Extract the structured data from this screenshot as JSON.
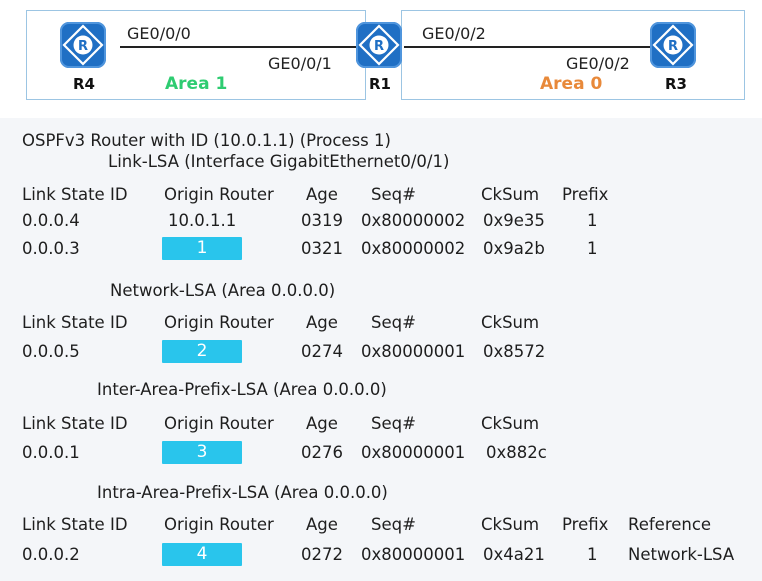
{
  "topology": {
    "routers": [
      {
        "id": "r4",
        "name": "R4"
      },
      {
        "id": "r1",
        "name": "R1"
      },
      {
        "id": "r3",
        "name": "R3"
      }
    ],
    "icon_letter": "R",
    "interfaces": {
      "r4_if": "GE0/0/0",
      "r1_left_if": "GE0/0/1",
      "r1_right_if": "GE0/0/2",
      "r3_if": "GE0/0/2"
    },
    "areas": {
      "area1": {
        "label": "Area 1",
        "color": "#2ecc71"
      },
      "area0": {
        "label": "Area 0",
        "color": "#e8893a"
      }
    },
    "colors": {
      "router": "#1f6fc4",
      "area_border": "#9cc5e3",
      "blank": "#29c5ec"
    }
  },
  "output": {
    "header": "OSPFv3 Router with ID (10.0.1.1) (Process 1)",
    "sections": {
      "link_lsa": {
        "title": "Link-LSA (Interface GigabitEthernet0/0/1)",
        "columns": [
          "Link State ID",
          "Origin Router",
          "Age",
          "Seq#",
          "CkSum",
          "Prefix"
        ],
        "rows": [
          {
            "link_state_id": "0.0.0.4",
            "origin_router": "10.0.1.1",
            "age": "0319",
            "seq": "0x80000002",
            "cksum": "0x9e35",
            "prefix": "1"
          },
          {
            "link_state_id": "0.0.0.3",
            "origin_router": "1",
            "age": "0321",
            "seq": "0x80000002",
            "cksum": "0x9a2b",
            "prefix": "1"
          }
        ]
      },
      "network_lsa": {
        "title": "Network-LSA (Area 0.0.0.0)",
        "columns": [
          "Link State ID",
          "Origin Router",
          "Age",
          "Seq#",
          "CkSum"
        ],
        "rows": [
          {
            "link_state_id": "0.0.0.5",
            "origin_router": "2",
            "age": "0274",
            "seq": "0x80000001",
            "cksum": "0x8572"
          }
        ]
      },
      "inter_area_prefix_lsa": {
        "title": "Inter-Area-Prefix-LSA (Area 0.0.0.0)",
        "columns": [
          "Link State ID",
          "Origin Router",
          "Age",
          "Seq#",
          "CkSum"
        ],
        "rows": [
          {
            "link_state_id": "0.0.0.1",
            "origin_router": "3",
            "age": "0276",
            "seq": "0x80000001",
            "cksum": "0x882c"
          }
        ]
      },
      "intra_area_prefix_lsa": {
        "title": "Intra-Area-Prefix-LSA (Area 0.0.0.0)",
        "columns": [
          "Link State ID",
          "Origin Router",
          "Age",
          "Seq#",
          "CkSum",
          "Prefix",
          "Reference"
        ],
        "rows": [
          {
            "link_state_id": "0.0.0.2",
            "origin_router": "4",
            "age": "0272",
            "seq": "0x80000001",
            "cksum": "0x4a21",
            "prefix": "1",
            "reference": "Network-LSA"
          }
        ]
      }
    }
  }
}
